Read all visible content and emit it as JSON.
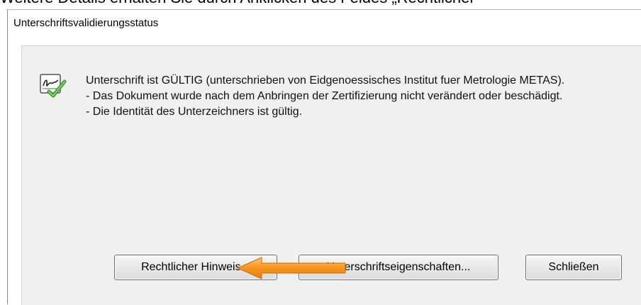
{
  "caption": "Weitere Details erhalten Sie durch Anklicken des Feldes „Rechtlicher",
  "dialog": {
    "title": "Unterschriftsvalidierungsstatus",
    "icon": "signature-valid-icon",
    "message_lines": [
      "Unterschrift ist GÜLTIG (unterschrieben von Eidgenoessisches Institut fuer Metrologie METAS).",
      "- Das Dokument wurde nach dem Anbringen der Zertifizierung nicht verändert oder beschädigt.",
      "- Die Identität des Unterzeichners ist gültig."
    ],
    "buttons": {
      "legal": "Rechtlicher Hinweis...",
      "properties": "Unterschriftseigenschaften...",
      "close": "Schließen"
    },
    "annotation_arrow_color": "#f7941d"
  }
}
